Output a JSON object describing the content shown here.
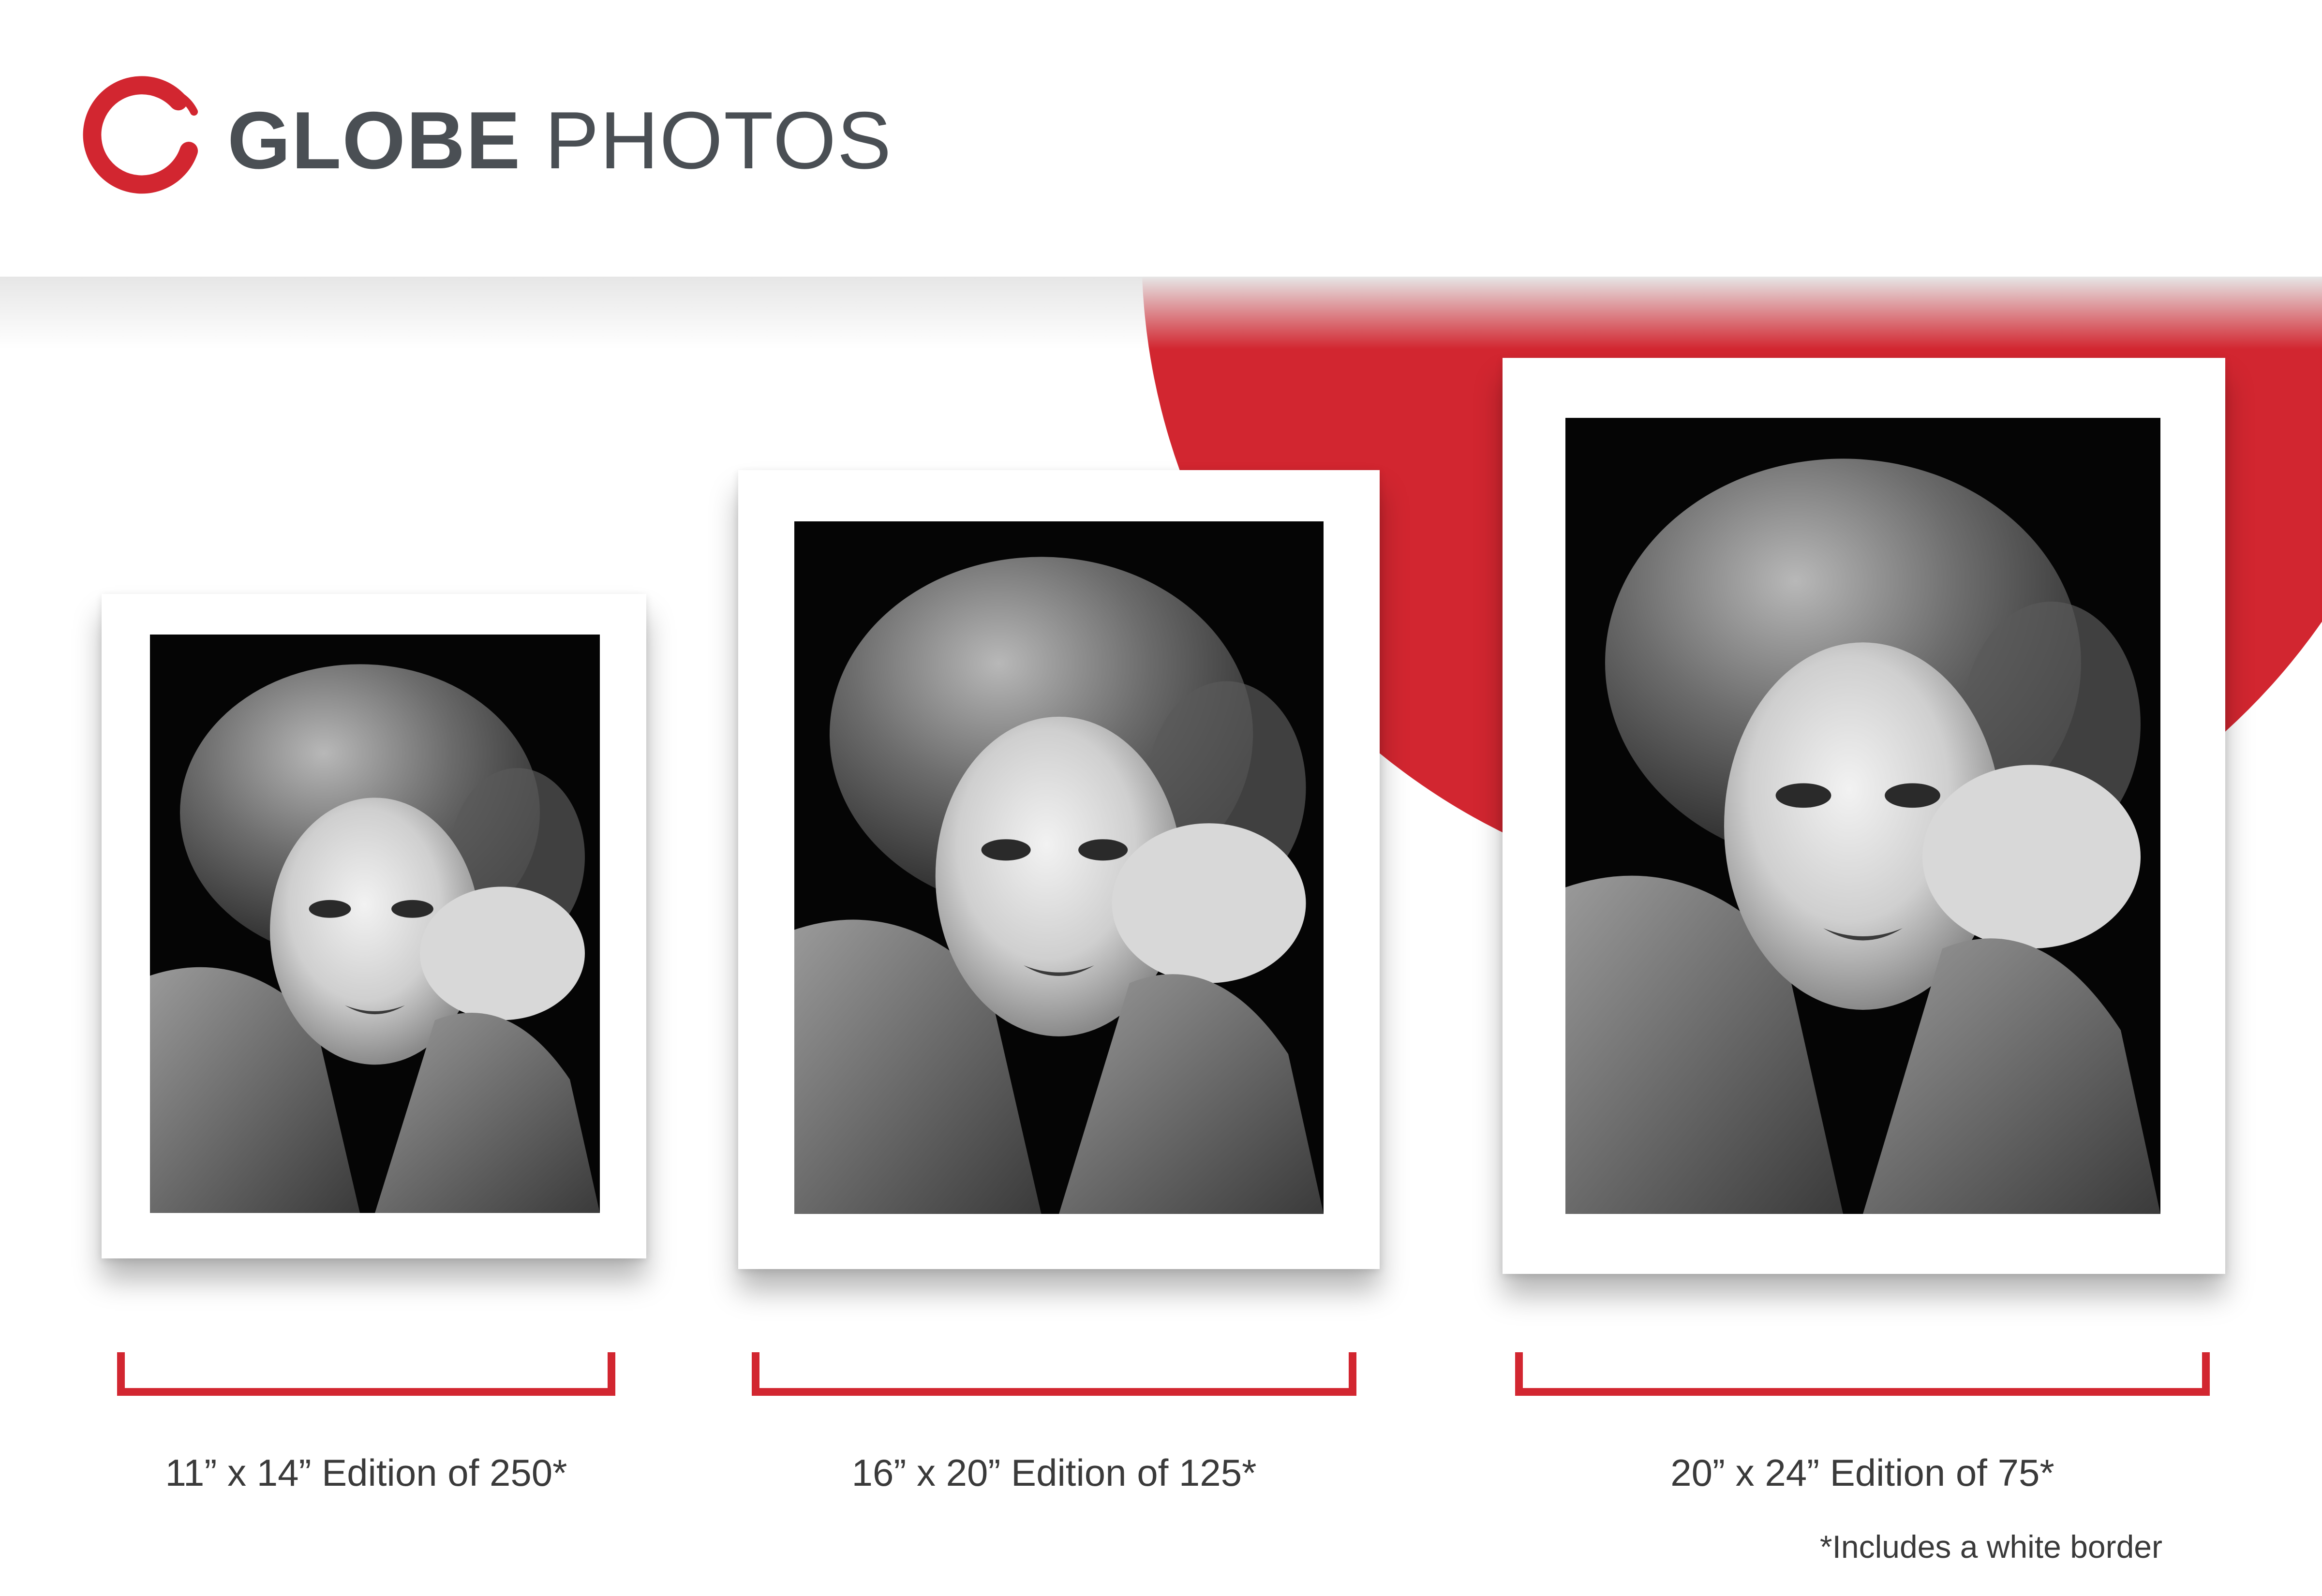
{
  "brand": {
    "name_bold": "GLOBE",
    "name_light": "PHOTOS",
    "logo_icon": "red-brush-ring-icon",
    "accent_color": "#d22630",
    "text_color": "#4a4f54"
  },
  "prints": [
    {
      "size": "11” x 14”",
      "caption": "11” x 14” Edition of 250*",
      "edition": 250
    },
    {
      "size": "16” x 20”",
      "caption": "16” x 20” Edition of 125*",
      "edition": 125
    },
    {
      "size": "20” x 24”",
      "caption": "20” x 24” Edition of 75*",
      "edition": 75
    }
  ],
  "footnote": "*Includes a white border"
}
